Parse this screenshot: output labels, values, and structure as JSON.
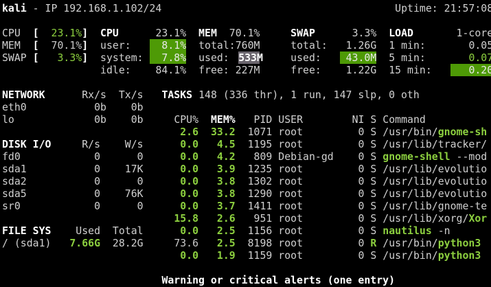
{
  "header": {
    "host": "kali",
    "ip": " - IP 192.168.1.102/24",
    "uptime": "Uptime: 21:57:08"
  },
  "quicklook": {
    "cpu_label": "CPU",
    "cpu_open": "[",
    "cpu_value": "23.1%",
    "cpu_close": "]",
    "mem_label": "MEM",
    "mem_open": "[",
    "mem_value": "70.1%",
    "mem_close": "]",
    "swap_label": "SWAP",
    "swap_open": "[",
    "swap_value": "3.3%",
    "swap_close": "]"
  },
  "cpu": {
    "title": "CPU",
    "total": "23.1%",
    "user_label": "user:",
    "user": "8.1%",
    "system_label": "system:",
    "system": "7.8%",
    "idle_label": "idle:",
    "idle": "84.1%"
  },
  "mem": {
    "title": "MEM",
    "percent": "70.1%",
    "total_label": "total:",
    "total": "760M",
    "used_label": "used:",
    "used": "533M",
    "free_label": "free:",
    "free": "227M"
  },
  "swap": {
    "title": "SWAP",
    "percent": "3.3%",
    "total_label": "total:",
    "total": "1.26G",
    "used_label": "used:",
    "used": "43.0M",
    "free_label": "free:",
    "free": "1.22G"
  },
  "load": {
    "title": "LOAD",
    "cores": "1-core",
    "min1_label": "1 min:",
    "min1": "0.05",
    "min5_label": "5 min:",
    "min5": "0.07",
    "min15_label": "15 min:",
    "min15": "0.20"
  },
  "network": {
    "title": "NETWORK",
    "rx_header": "Rx/s",
    "tx_header": "Tx/s",
    "rows": [
      {
        "name": "eth0",
        "rx": "0b",
        "tx": "0b"
      },
      {
        "name": "lo",
        "rx": "0b",
        "tx": "0b"
      }
    ]
  },
  "disk": {
    "title": "DISK I/O",
    "r_header": "R/s",
    "w_header": "W/s",
    "rows": [
      {
        "name": "fd0",
        "r": "0",
        "w": "0"
      },
      {
        "name": "sda1",
        "r": "0",
        "w": "17K"
      },
      {
        "name": "sda2",
        "r": "0",
        "w": "0"
      },
      {
        "name": "sda5",
        "r": "0",
        "w": "76K"
      },
      {
        "name": "sr0",
        "r": "0",
        "w": "0"
      }
    ]
  },
  "fs": {
    "title": "FILE SYS",
    "used_header": "Used",
    "total_header": "Total",
    "rows": [
      {
        "name": "/ (sda1)",
        "used": "7.66G",
        "total": "28.2G"
      }
    ]
  },
  "tasks": {
    "title": "TASKS",
    "summary": "148 (336 thr), 1 run, 147 slp, 0 oth"
  },
  "processes": {
    "headers": {
      "cpu": "CPU%",
      "mem": "MEM%",
      "pid": "PID",
      "user": "USER",
      "ni": "NI",
      "s": "S",
      "command": "Command"
    },
    "rows": [
      {
        "cpu": "2.6",
        "mem": "33.2",
        "pid": "1071",
        "user": "root",
        "ni": "0",
        "s": "S",
        "cmd_pre": "/usr/bin/",
        "cmd_hl": "gnome-sh",
        "cmd_post": ""
      },
      {
        "cpu": "0.0",
        "mem": "4.5",
        "pid": "1195",
        "user": "root",
        "ni": "0",
        "s": "S",
        "cmd_pre": "/usr/lib/tracker/",
        "cmd_hl": "",
        "cmd_post": ""
      },
      {
        "cpu": "0.0",
        "mem": "4.2",
        "pid": "809",
        "user": "Debian-gd",
        "ni": "0",
        "s": "S",
        "cmd_pre": "",
        "cmd_hl": "gnome-shell",
        "cmd_post": " --mod"
      },
      {
        "cpu": "0.0",
        "mem": "3.9",
        "pid": "1235",
        "user": "root",
        "ni": "0",
        "s": "S",
        "cmd_pre": "/usr/lib/evolutio",
        "cmd_hl": "",
        "cmd_post": ""
      },
      {
        "cpu": "0.0",
        "mem": "3.8",
        "pid": "1302",
        "user": "root",
        "ni": "0",
        "s": "S",
        "cmd_pre": "/usr/lib/evolutio",
        "cmd_hl": "",
        "cmd_post": ""
      },
      {
        "cpu": "0.0",
        "mem": "3.8",
        "pid": "1290",
        "user": "root",
        "ni": "0",
        "s": "S",
        "cmd_pre": "/usr/lib/evolutio",
        "cmd_hl": "",
        "cmd_post": ""
      },
      {
        "cpu": "0.0",
        "mem": "3.7",
        "pid": "1411",
        "user": "root",
        "ni": "0",
        "s": "S",
        "cmd_pre": "/usr/lib/gnome-te",
        "cmd_hl": "",
        "cmd_post": ""
      },
      {
        "cpu": "15.8",
        "mem": "2.6",
        "pid": "951",
        "user": "root",
        "ni": "0",
        "s": "S",
        "cmd_pre": "/usr/lib/xorg/",
        "cmd_hl": "Xor",
        "cmd_post": ""
      },
      {
        "cpu": "0.0",
        "mem": "2.5",
        "pid": "1156",
        "user": "root",
        "ni": "0",
        "s": "S",
        "cmd_pre": "",
        "cmd_hl": "nautilus",
        "cmd_post": " -n"
      },
      {
        "cpu": "73.6",
        "mem": "2.5",
        "pid": "8198",
        "user": "root",
        "ni": "0",
        "s": "R",
        "cmd_pre": "/usr/bin/",
        "cmd_hl": "python3",
        "cmd_post": ""
      },
      {
        "cpu": "0.0",
        "mem": "1.9",
        "pid": "1159",
        "user": "root",
        "ni": "0",
        "s": "S",
        "cmd_pre": "/usr/bin/",
        "cmd_hl": "python3",
        "cmd_post": ""
      }
    ]
  },
  "alerts": {
    "title": "Warning or critical alerts (one entry)"
  },
  "colors": {
    "green": "#8ccf3f",
    "highlight": "#4e9a06",
    "mem_bar": "#6b666e"
  }
}
